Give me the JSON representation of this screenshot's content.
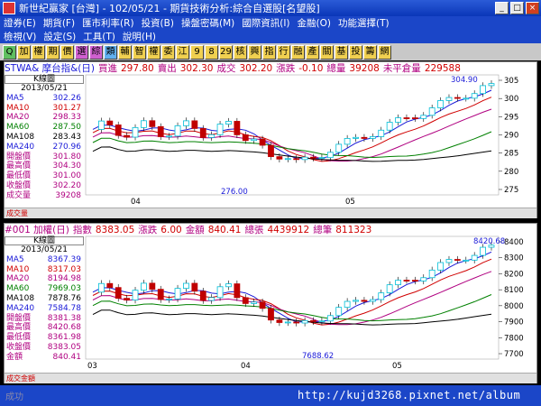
{
  "window": {
    "title": "新世紀贏家 [台灣] - 102/05/21 - 期貨技術分析:綜合自選股[名望股]"
  },
  "menu": {
    "row1": [
      "證券(E)",
      "期貨(F)",
      "匯市利率(R)",
      "投資(B)",
      "操盤密碼(M)",
      "國際資訊(I)",
      "金融(O)",
      "功能選擇(T)"
    ],
    "row2": [
      "檢視(V)",
      "設定(S)",
      "工具(T)",
      "說明(H)"
    ]
  },
  "toolbar": [
    "Q",
    "加",
    "權",
    "期",
    "價",
    "選",
    "綜",
    "類",
    "輔",
    "智",
    "權",
    "委",
    "江",
    "9",
    "8",
    "29",
    "核",
    "興",
    "指",
    "行",
    "融",
    "產",
    "關",
    "基",
    "投",
    "籌",
    "網"
  ],
  "panel1": {
    "symbol": "STWA& 摩台指&(日)",
    "quote": [
      {
        "label": "買進",
        "value": "297.80"
      },
      {
        "label": "賣出",
        "value": "302.30"
      },
      {
        "label": "成交",
        "value": "302.20"
      },
      {
        "label": "漲跌",
        "value": "-0.10"
      },
      {
        "label": "總量",
        "value": "39208"
      },
      {
        "label": "未平倉量",
        "value": "229588"
      }
    ],
    "legend_title": "K線圖",
    "legend_date": "2013/05/21",
    "legend": [
      {
        "k": "MA5",
        "v": "302.26",
        "color": "#1a1ad8"
      },
      {
        "k": "MA10",
        "v": "301.27",
        "color": "#d00000"
      },
      {
        "k": "MA20",
        "v": "298.33",
        "color": "#b00080"
      },
      {
        "k": "MA60",
        "v": "287.50",
        "color": "#008000"
      },
      {
        "k": "MA108",
        "v": "283.43",
        "color": "#000000"
      },
      {
        "k": "MA240",
        "v": "270.96",
        "color": "#1a1ad8"
      },
      {
        "k": "開盤價",
        "v": "301.80",
        "color": "#b00080"
      },
      {
        "k": "最高價",
        "v": "304.30",
        "color": "#b00080"
      },
      {
        "k": "最低價",
        "v": "301.00",
        "color": "#b00080"
      },
      {
        "k": "收盤價",
        "v": "302.20",
        "color": "#b00080"
      },
      {
        "k": "成交量",
        "v": "39208",
        "color": "#b00080"
      }
    ],
    "y_ticks": [
      "305",
      "300",
      "295",
      "290",
      "285",
      "280",
      "275"
    ],
    "x_labels": [
      "04",
      "05"
    ],
    "annot_high": "304.90",
    "annot_low": "276.00",
    "foot_label": "成交量"
  },
  "panel2": {
    "symbol": "#001 加權(日)",
    "quote": [
      {
        "label": "指數",
        "value": "8383.05"
      },
      {
        "label": "漲跌",
        "value": "6.00"
      },
      {
        "label": "金額",
        "value": "840.41"
      },
      {
        "label": "總張",
        "value": "4439912"
      },
      {
        "label": "總筆",
        "value": "811323"
      }
    ],
    "legend_title": "K線圖",
    "legend_date": "2013/05/21",
    "legend": [
      {
        "k": "MA5",
        "v": "8367.39",
        "color": "#1a1ad8"
      },
      {
        "k": "MA10",
        "v": "8317.03",
        "color": "#d00000"
      },
      {
        "k": "MA20",
        "v": "8194.98",
        "color": "#b00080"
      },
      {
        "k": "MA60",
        "v": "7969.03",
        "color": "#008000"
      },
      {
        "k": "MA108",
        "v": "7878.76",
        "color": "#000000"
      },
      {
        "k": "MA240",
        "v": "7584.78",
        "color": "#1a1ad8"
      },
      {
        "k": "開盤價",
        "v": "8381.38",
        "color": "#b00080"
      },
      {
        "k": "最高價",
        "v": "8420.68",
        "color": "#b00080"
      },
      {
        "k": "最低價",
        "v": "8361.98",
        "color": "#b00080"
      },
      {
        "k": "收盤價",
        "v": "8383.05",
        "color": "#b00080"
      },
      {
        "k": "金額",
        "v": "840.41",
        "color": "#b00080"
      }
    ],
    "y_ticks": [
      "8400",
      "8300",
      "8200",
      "8100",
      "8000",
      "7900",
      "7800",
      "7700"
    ],
    "x_labels": [
      "03",
      "04",
      "05"
    ],
    "annot_high": "8420.68",
    "annot_low": "7688.62",
    "foot_label": "成交金額"
  },
  "status": {
    "message": "成功",
    "url": "http://kujd3268.pixnet.net/album"
  },
  "colors": {
    "titlebar": "#0a36b8",
    "menubar": "#1b46c8",
    "toolbar": "#c8c8c8",
    "up": "#d00000",
    "down": "#008000"
  }
}
